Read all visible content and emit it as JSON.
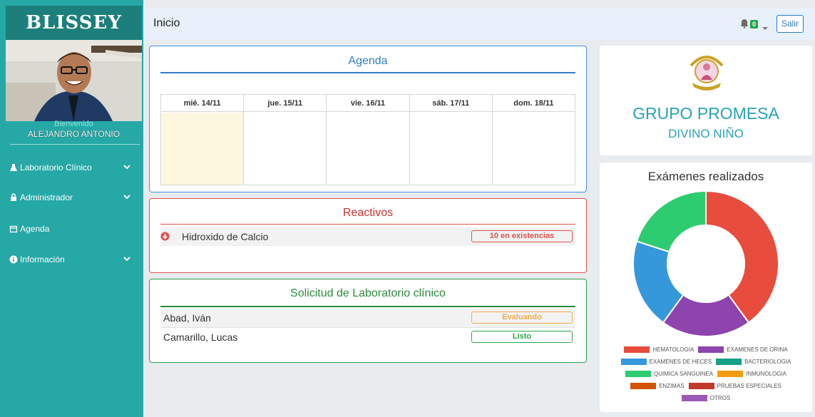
{
  "sidebar": {
    "brand": "BLISSEY",
    "welcome": "Bienvenido",
    "user_name": "ALEJANDRO ANTONIO",
    "menu": [
      {
        "label": "Laboratorio Clínico",
        "icon": "flask-icon",
        "has_submenu": true
      },
      {
        "label": "Administrador",
        "icon": "lock-icon",
        "has_submenu": true
      },
      {
        "label": "Agenda",
        "icon": "calendar-icon",
        "has_submenu": false
      },
      {
        "label": "Información",
        "icon": "info-icon",
        "has_submenu": true
      }
    ]
  },
  "header": {
    "title": "Inicio",
    "notifications_count": "0",
    "logout_label": "Salir"
  },
  "agenda": {
    "title": "Agenda",
    "days": [
      "mié. 14/11",
      "jue. 15/11",
      "vie. 16/11",
      "sáb. 17/11",
      "dom. 18/11"
    ],
    "highlight_color": "#fdf7e0"
  },
  "reactivos": {
    "title": "Reactivos",
    "items": [
      {
        "name": "Hidroxido de Calcio",
        "status": "10 en existencias",
        "icon": "arrow-down-circle-icon"
      }
    ]
  },
  "solicitud": {
    "title": "Solicitud de Laboratorio clínico",
    "items": [
      {
        "name": "Abad, Iván",
        "status": "Evaluando",
        "color": "#f0ad4e"
      },
      {
        "name": "Camarillo, Lucas",
        "status": "Listo",
        "color": "#28a745"
      }
    ]
  },
  "brand_card": {
    "title": "GRUPO PROMESA",
    "subtitle": "DIVINO NIÑO",
    "seal_icon": "hospital-seal-icon"
  },
  "chart_data": {
    "type": "pie",
    "title": "Exámenes realizados",
    "series": [
      {
        "name": "HEMATOLOGIA",
        "value": 40,
        "color": "#e74c3c"
      },
      {
        "name": "EXAMENES DE ORINA",
        "value": 20,
        "color": "#8e44ad"
      },
      {
        "name": "EXAMENES DE HECES",
        "value": 20,
        "color": "#3498db"
      },
      {
        "name": "BACTERIOLOGIA",
        "value": 0,
        "color": "#16a085"
      },
      {
        "name": "QUIMICA SANGUINEA",
        "value": 20,
        "color": "#2ecc71"
      },
      {
        "name": "INMUNOLOGIA",
        "value": 0,
        "color": "#f39c12"
      },
      {
        "name": "ENZIMAS",
        "value": 0,
        "color": "#d35400"
      },
      {
        "name": "PRUEBAS ESPECIALES",
        "value": 0,
        "color": "#c0392b"
      },
      {
        "name": "OTROS",
        "value": 0,
        "color": "#9b59b6"
      }
    ],
    "legend": "bottom"
  }
}
